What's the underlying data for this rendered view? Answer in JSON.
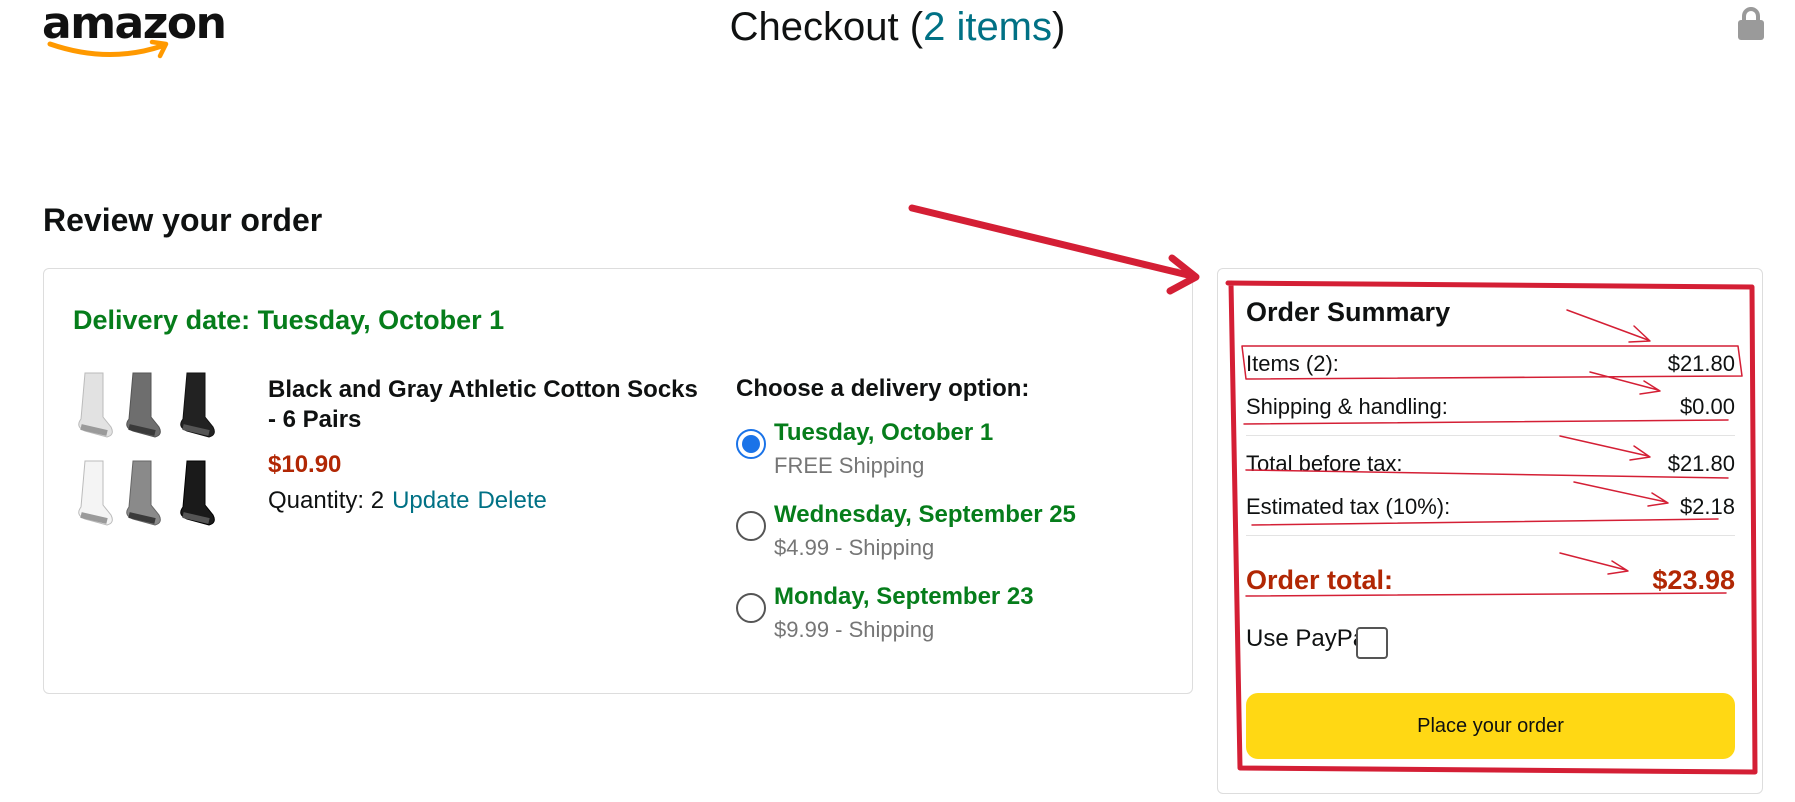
{
  "header": {
    "logo_text": "amazon",
    "checkout_prefix": "Checkout (",
    "items_link": "2 items",
    "checkout_suffix": ")",
    "lock_icon": "lock-icon"
  },
  "review": {
    "heading": "Review your order"
  },
  "order": {
    "delivery_date": "Delivery date: Tuesday, October 1",
    "product": {
      "name": "Black and Gray Athletic Cotton Socks - 6 Pairs",
      "price": "$10.90",
      "quantity_text": "Quantity: 2",
      "update_label": "Update",
      "delete_label": "Delete"
    },
    "delivery_heading": "Choose a delivery option:",
    "options": [
      {
        "date": "Tuesday, October 1",
        "shipping": "FREE Shipping",
        "selected": true
      },
      {
        "date": "Wednesday, September 25",
        "shipping": "$4.99 - Shipping",
        "selected": false
      },
      {
        "date": "Monday, September 23",
        "shipping": "$9.99 - Shipping",
        "selected": false
      }
    ]
  },
  "summary": {
    "title": "Order Summary",
    "rows": [
      {
        "label": "Items (2):",
        "value": "$21.80"
      },
      {
        "label": "Shipping & handling:",
        "value": "$0.00"
      },
      {
        "label": "Total before tax:",
        "value": "$21.80"
      },
      {
        "label": "Estimated tax (10%):",
        "value": "$2.18"
      }
    ],
    "total_label": "Order total:",
    "total_value": "$23.98",
    "paypal_label": "Use PayPal",
    "place_order_label": "Place your order"
  },
  "colors": {
    "annotation": "#d41f35",
    "price": "#b12704",
    "delivery_green": "#067d1b",
    "link": "#007185",
    "button": "#ffd814"
  }
}
